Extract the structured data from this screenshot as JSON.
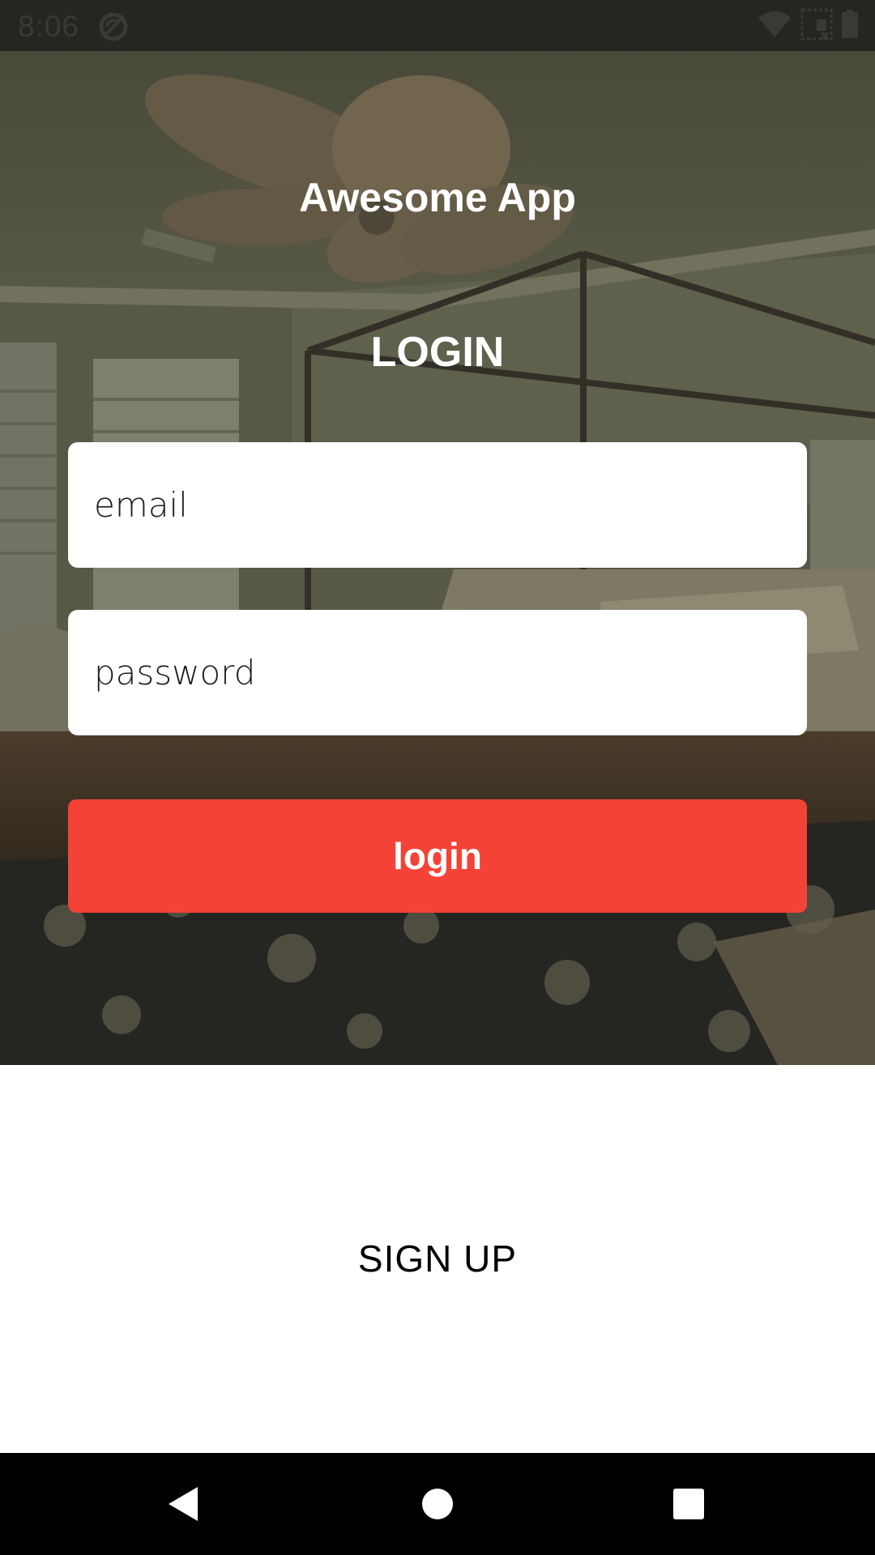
{
  "status_bar": {
    "time": "8:06",
    "icons": [
      "sync-icon",
      "wifi-off-icon",
      "no-signal-icon",
      "battery-icon"
    ]
  },
  "app": {
    "title": "Awesome App",
    "heading": "LOGIN"
  },
  "form": {
    "email_placeholder": "email",
    "password_placeholder": "password",
    "login_label": "login"
  },
  "signup": {
    "label": "SIGN UP"
  },
  "nav": {
    "icons": [
      "back-icon",
      "home-icon",
      "recents-icon"
    ]
  },
  "colors": {
    "accent": "#f44336",
    "field_background": "#ffffff",
    "nav_background": "#000000"
  }
}
